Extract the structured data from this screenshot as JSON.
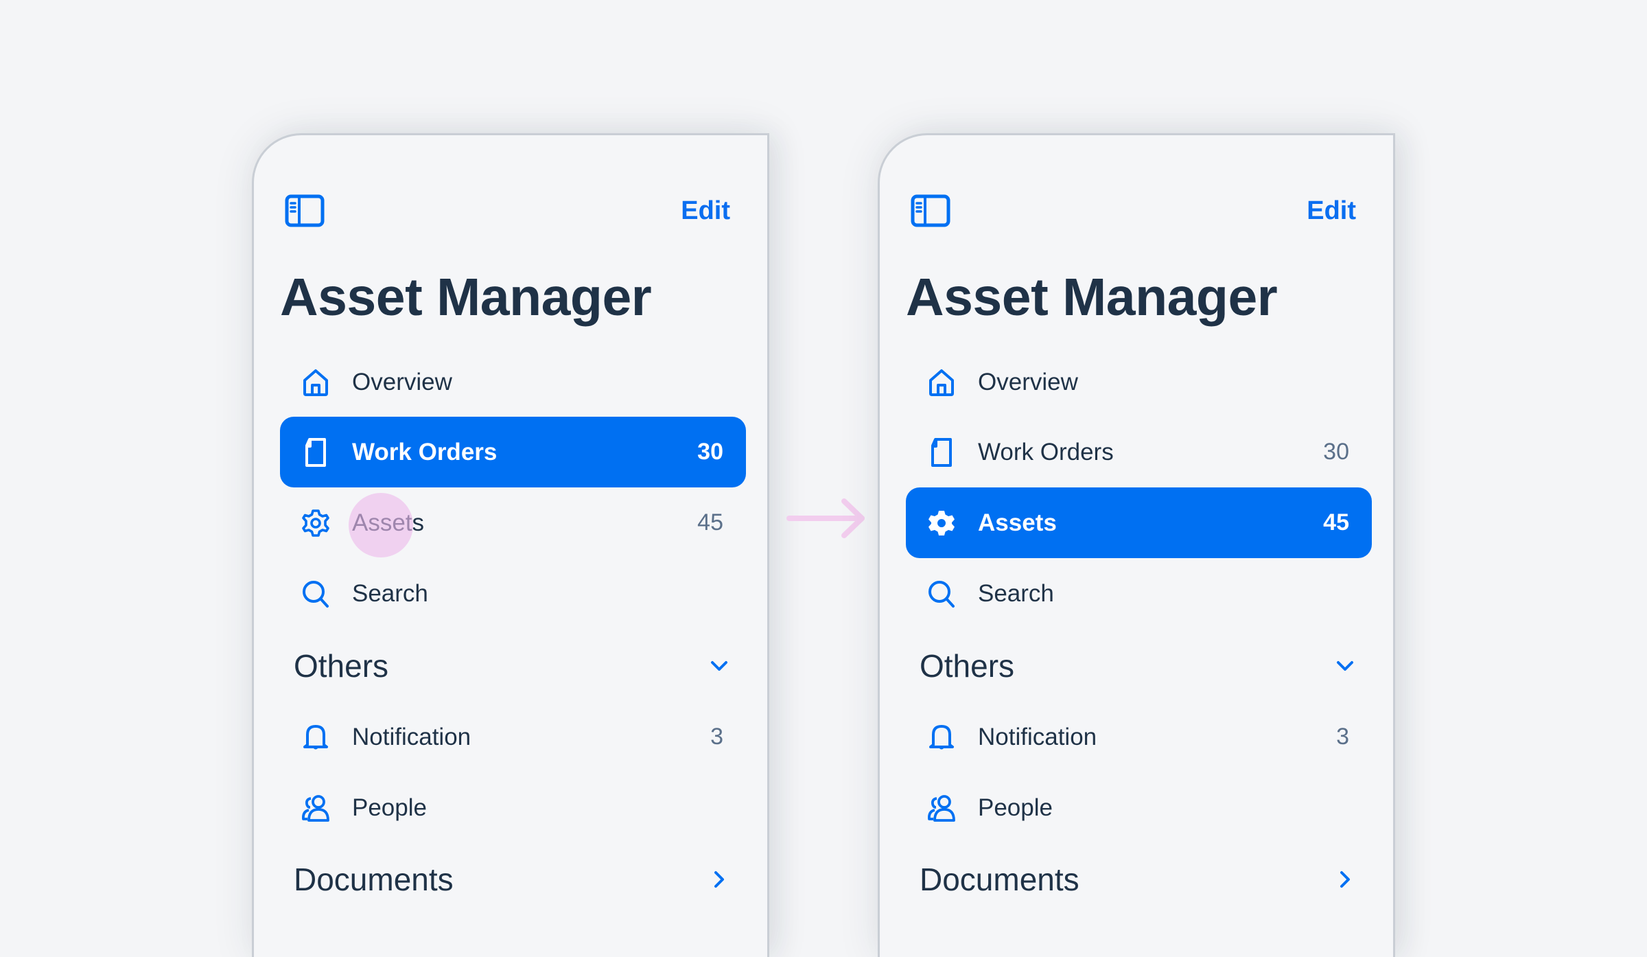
{
  "colors": {
    "accent": "#0070f2",
    "text": "#1f3247",
    "count": "#5b708a",
    "touch": "#f2c9ee",
    "background": "#f4f5f7"
  },
  "panels": [
    {
      "state": "before",
      "header": {
        "toggle_icon": "sidebar-toggle-icon",
        "edit_label": "Edit",
        "title": "Asset Manager"
      },
      "items": [
        {
          "label": "Overview",
          "icon": "home-icon",
          "count": "",
          "active": false
        },
        {
          "label": "Work Orders",
          "icon": "document-icon",
          "count": "30",
          "active": true
        },
        {
          "label": "Assets",
          "icon": "gear-icon",
          "count": "45",
          "active": false,
          "touched": true
        },
        {
          "label": "Search",
          "icon": "search-icon",
          "count": "",
          "active": false
        }
      ],
      "groups": [
        {
          "label": "Others",
          "expanded": true,
          "chevron": "chevron-down-icon",
          "items": [
            {
              "label": "Notification",
              "icon": "bell-icon",
              "count": "3"
            },
            {
              "label": "People",
              "icon": "people-icon",
              "count": ""
            }
          ]
        },
        {
          "label": "Documents",
          "expanded": false,
          "chevron": "chevron-right-icon",
          "items": []
        }
      ]
    },
    {
      "state": "after",
      "header": {
        "toggle_icon": "sidebar-toggle-icon",
        "edit_label": "Edit",
        "title": "Asset Manager"
      },
      "items": [
        {
          "label": "Overview",
          "icon": "home-icon",
          "count": "",
          "active": false
        },
        {
          "label": "Work Orders",
          "icon": "document-icon",
          "count": "30",
          "active": false
        },
        {
          "label": "Assets",
          "icon": "gear-icon",
          "count": "45",
          "active": true
        },
        {
          "label": "Search",
          "icon": "search-icon",
          "count": "",
          "active": false
        }
      ],
      "groups": [
        {
          "label": "Others",
          "expanded": true,
          "chevron": "chevron-down-icon",
          "items": [
            {
              "label": "Notification",
              "icon": "bell-icon",
              "count": "3"
            },
            {
              "label": "People",
              "icon": "people-icon",
              "count": ""
            }
          ]
        },
        {
          "label": "Documents",
          "expanded": false,
          "chevron": "chevron-right-icon",
          "items": []
        }
      ]
    }
  ],
  "transition": {
    "icon": "arrow-right-icon"
  }
}
